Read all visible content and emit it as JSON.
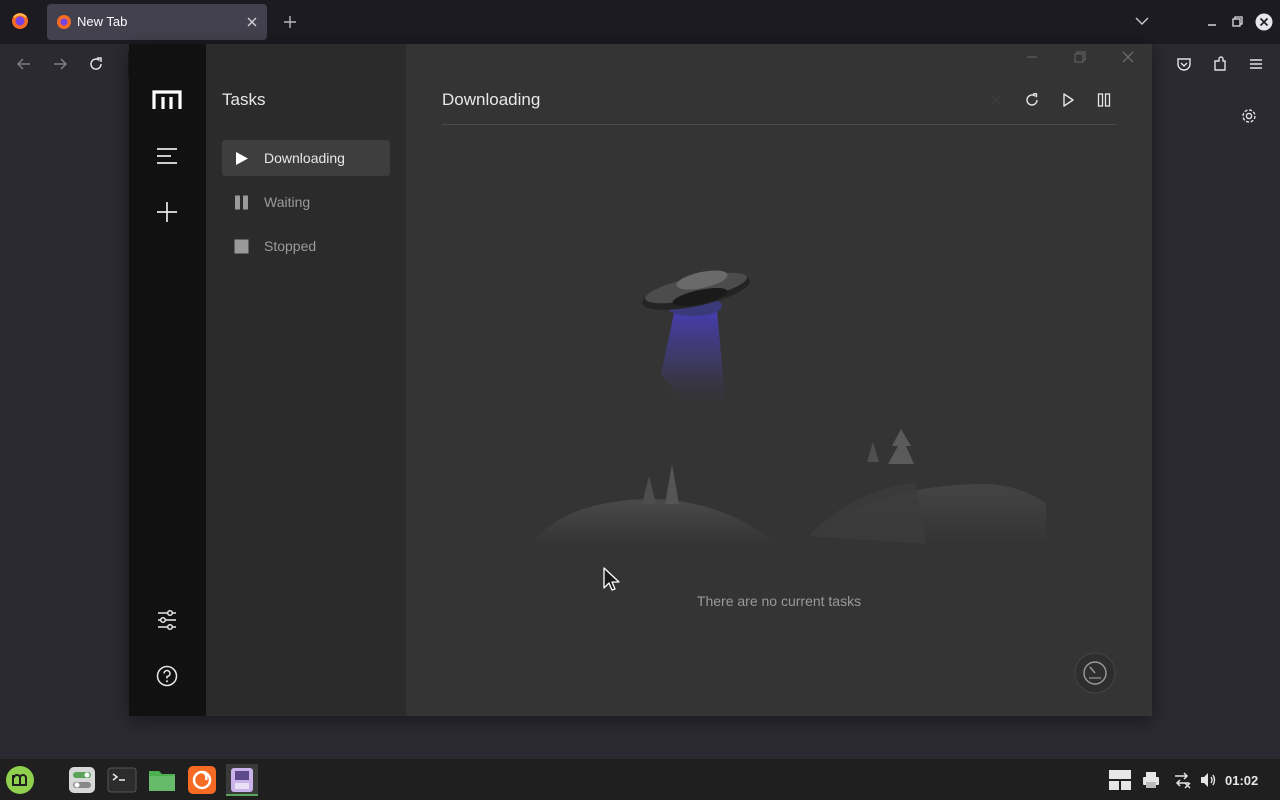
{
  "browser": {
    "tab_title": "New Tab"
  },
  "motrix": {
    "subnav_title": "Tasks",
    "subnav_items": [
      {
        "label": "Downloading",
        "icon": "play-icon",
        "active": true
      },
      {
        "label": "Waiting",
        "icon": "pause-icon",
        "active": false
      },
      {
        "label": "Stopped",
        "icon": "stop-icon",
        "active": false
      }
    ],
    "main_title": "Downloading",
    "empty_text": "There are no current tasks"
  },
  "taskbar": {
    "clock": "01:02"
  },
  "colors": {
    "firefox_tabbar": "#1c1b22",
    "motrix_aside": "#111111",
    "motrix_main": "#343434",
    "mint_green": "#8fd14f",
    "firefox_orange": "#f56b24"
  }
}
